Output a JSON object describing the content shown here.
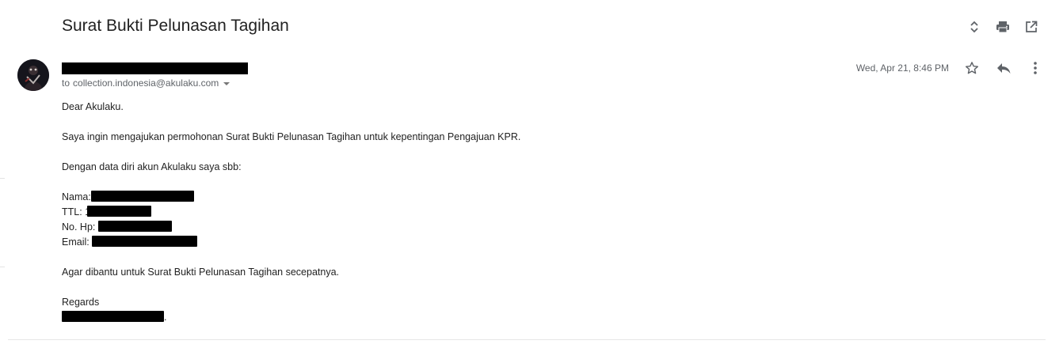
{
  "email": {
    "subject": "Surat Bukti Pelunasan Tagihan",
    "sender_name": "",
    "recipient_prefix": "to",
    "recipient": "collection.indonesia@akulaku.com",
    "date": "Wed, Apr 21, 8:46 PM",
    "body": {
      "greeting": "Dear Akulaku.",
      "paragraph1": "Saya ingin mengajukan permohonan Surat Bukti Pelunasan Tagihan untuk kepentingan Pengajuan KPR.",
      "paragraph2": "Dengan data diri akun Akulaku saya sbb:",
      "fields": {
        "name_label": "Nama:",
        "ttl_label": "TTL:",
        "ttl_visible_prefix": "1",
        "phone_label": "No. Hp:",
        "email_label": "Email:"
      },
      "paragraph3": "Agar dibantu untuk Surat Bukti Pelunasan Tagihan secepatnya.",
      "closing": "Regards",
      "signature_suffix": "."
    }
  },
  "icons": {
    "top": [
      "expand-collapse-icon",
      "print-icon",
      "open-in-new-window-icon"
    ],
    "message": [
      "star-icon",
      "reply-icon",
      "more-vert-icon"
    ]
  },
  "colors": {
    "text": "#222222",
    "muted": "#5f6368",
    "icon": "#5f6368",
    "redaction": "#000000"
  }
}
